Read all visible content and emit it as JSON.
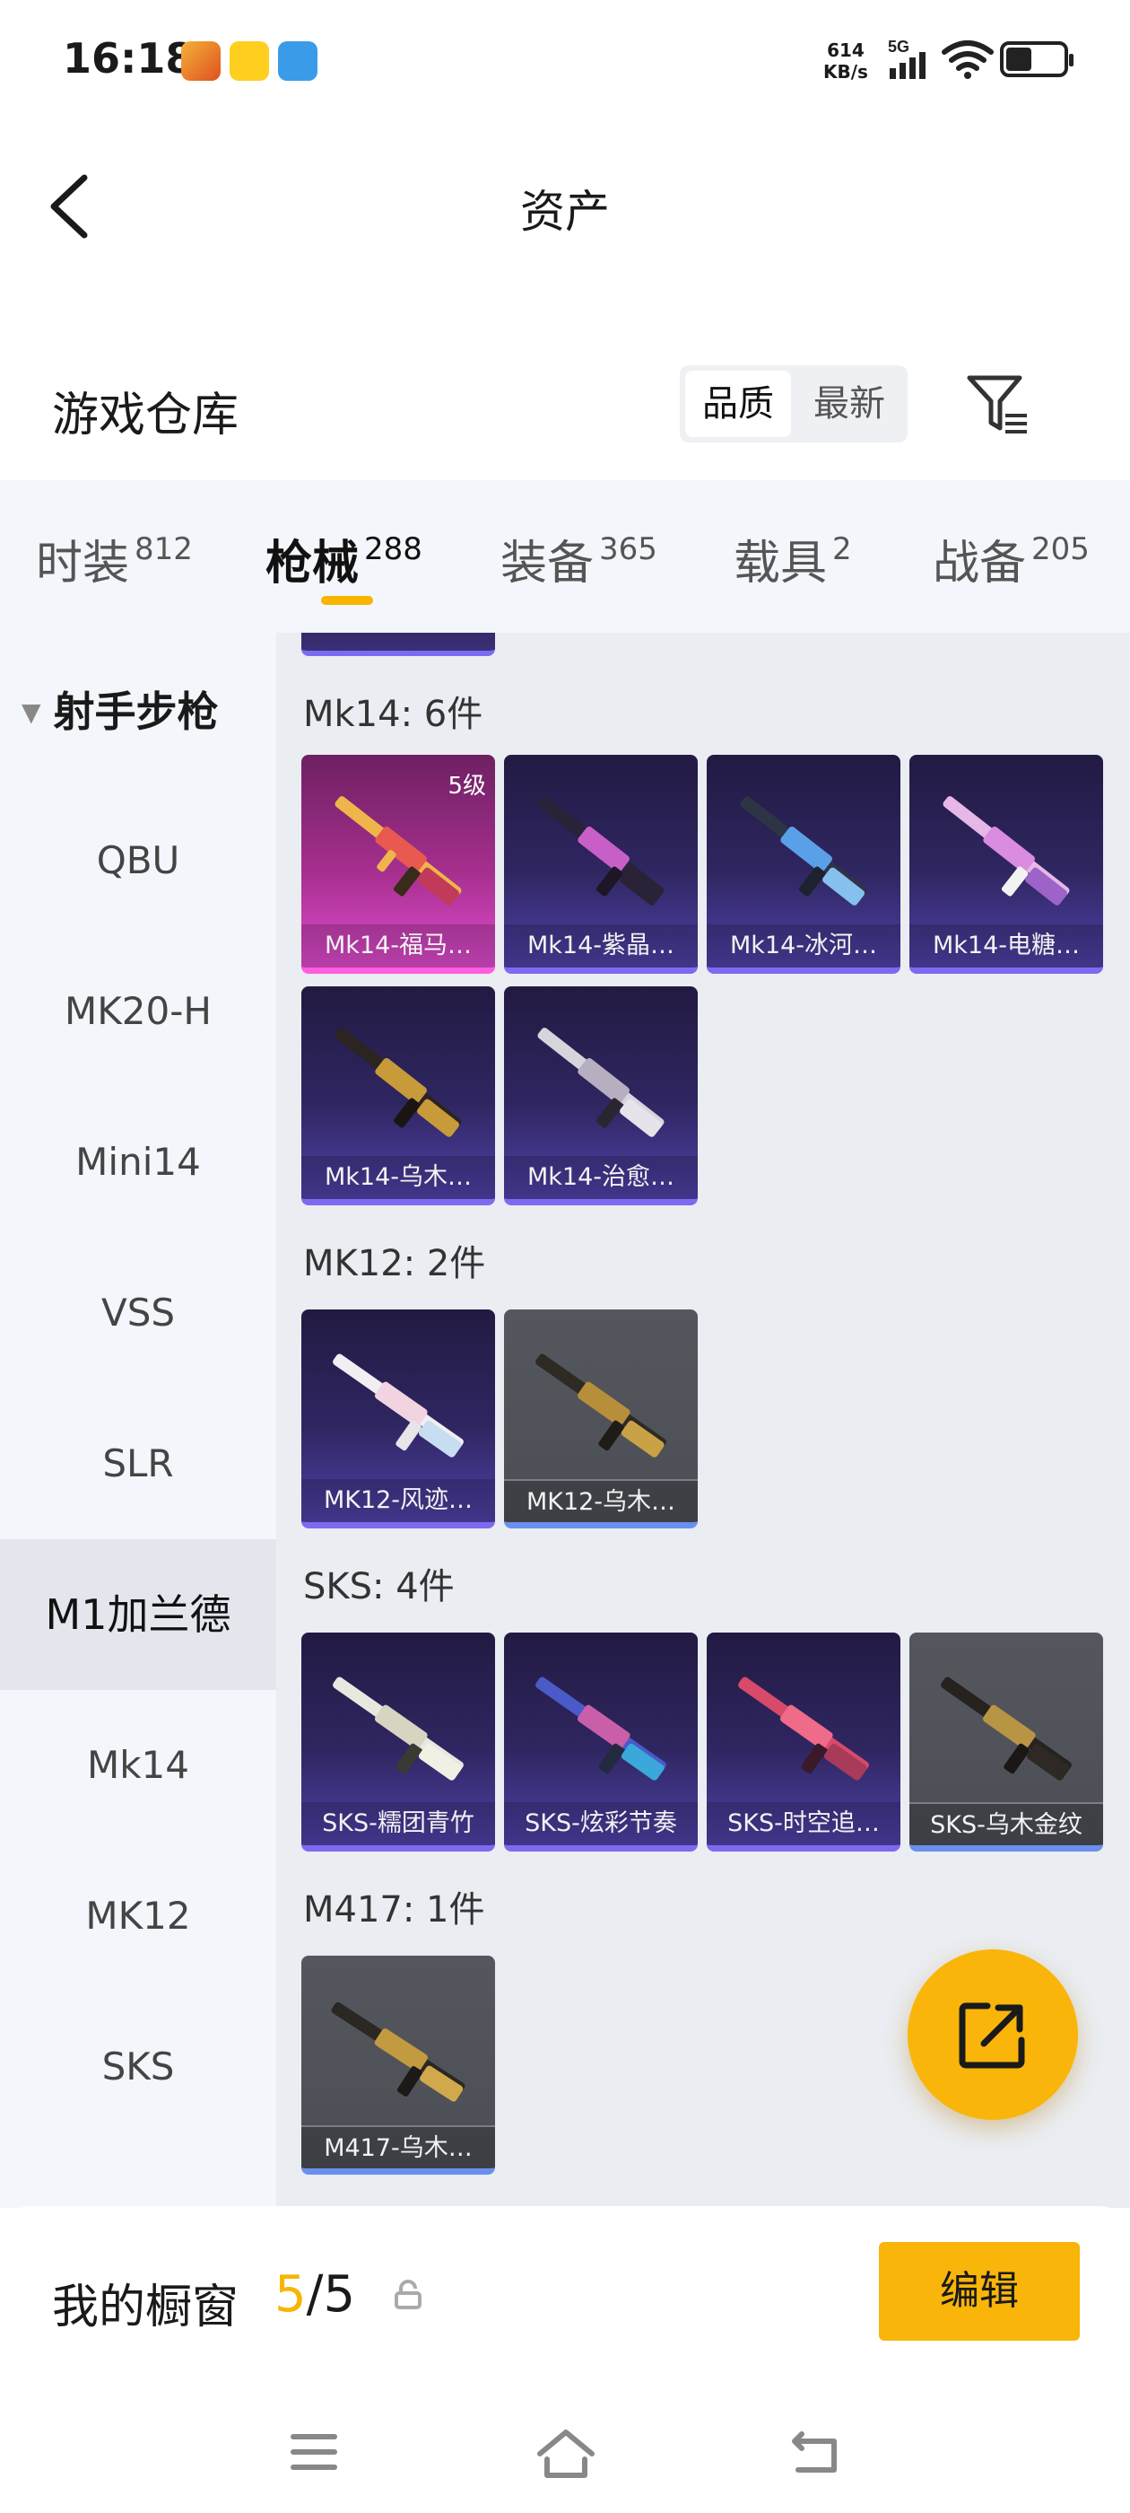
{
  "status_bar": {
    "time": "16:18",
    "net_speed_value": "614",
    "net_speed_unit": "KB/s",
    "network_type": "5G",
    "battery_level": 0.45
  },
  "header": {
    "title": "资产"
  },
  "warehouse": {
    "title": "游戏仓库",
    "sort_options": [
      "品质",
      "最新"
    ],
    "sort_selected": "品质"
  },
  "tabs": [
    {
      "label": "时装",
      "count": "812"
    },
    {
      "label": "枪械",
      "count": "288"
    },
    {
      "label": "装备",
      "count": "365"
    },
    {
      "label": "载具",
      "count": "2"
    },
    {
      "label": "战备",
      "count": "205"
    }
  ],
  "active_tab": "枪械",
  "sidebar": {
    "category": "射手步枪",
    "items": [
      "QBU",
      "MK20-H",
      "Mini14",
      "VSS",
      "SLR",
      "M1加兰德",
      "Mk14",
      "MK12",
      "SKS"
    ],
    "active_item": "M1加兰德"
  },
  "groups": [
    {
      "title": "Mk14: 6件",
      "items": [
        {
          "label": "Mk14-福马…",
          "level": "5级",
          "rarity": "pink"
        },
        {
          "label": "Mk14-紫晶…",
          "rarity": "purple"
        },
        {
          "label": "Mk14-冰河…",
          "rarity": "purple"
        },
        {
          "label": "Mk14-电糖…",
          "rarity": "purple"
        },
        {
          "label": "Mk14-乌木…",
          "rarity": "purple"
        },
        {
          "label": "Mk14-治愈…",
          "rarity": "purple"
        }
      ]
    },
    {
      "title": "MK12: 2件",
      "items": [
        {
          "label": "MK12-风迹…",
          "rarity": "purple"
        },
        {
          "label": "MK12-乌木…",
          "rarity": "grey"
        }
      ]
    },
    {
      "title": "SKS: 4件",
      "items": [
        {
          "label": "SKS-糯团青竹",
          "rarity": "purple"
        },
        {
          "label": "SKS-炫彩节奏",
          "rarity": "purple"
        },
        {
          "label": "SKS-时空追…",
          "rarity": "purple"
        },
        {
          "label": "SKS-乌木金纹",
          "rarity": "grey"
        }
      ]
    },
    {
      "title": "M417: 1件",
      "items": [
        {
          "label": "M417-乌木…",
          "rarity": "grey"
        }
      ]
    }
  ],
  "showcase": {
    "label": "我的橱窗",
    "current": "5",
    "separator": "/",
    "total": "5",
    "edit_label": "编辑"
  },
  "colors": {
    "accent": "#f9b50a",
    "purple_border": "#7c6bf0",
    "pink_border": "#ff5ddf",
    "grey_border": "#6a8fee"
  },
  "icons": [
    "back-arrow-icon",
    "filter-icon",
    "share-export-icon",
    "lock-icon",
    "menu-icon",
    "home-icon",
    "back-nav-icon"
  ]
}
